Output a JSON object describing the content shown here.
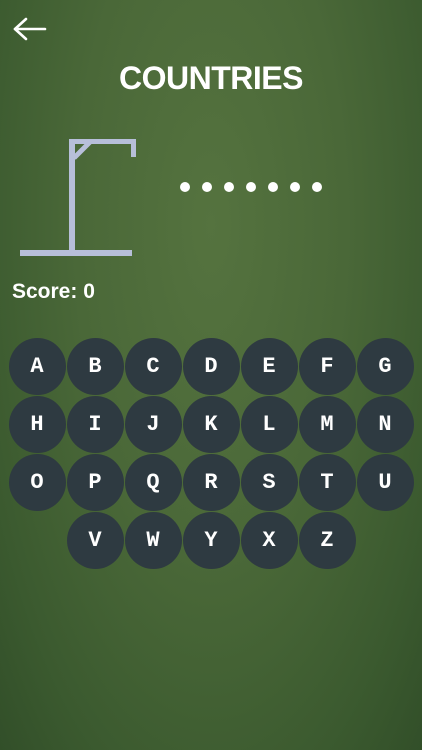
{
  "header": {
    "back_icon": "arrow-left-icon",
    "title": "COUNTRIES"
  },
  "game": {
    "word_dot_count": 7,
    "score_label": "Score: 0"
  },
  "keyboard": {
    "rows": [
      [
        "A",
        "B",
        "C",
        "D",
        "E",
        "F",
        "G"
      ],
      [
        "H",
        "I",
        "J",
        "K",
        "L",
        "M",
        "N"
      ],
      [
        "O",
        "P",
        "Q",
        "R",
        "S",
        "T",
        "U"
      ],
      [
        "V",
        "W",
        "Y",
        "X",
        "Z"
      ]
    ]
  },
  "colors": {
    "background": "#4a6838",
    "key_background": "#2e3a41",
    "gallows": "#b7bfd9",
    "text": "#ffffff"
  }
}
